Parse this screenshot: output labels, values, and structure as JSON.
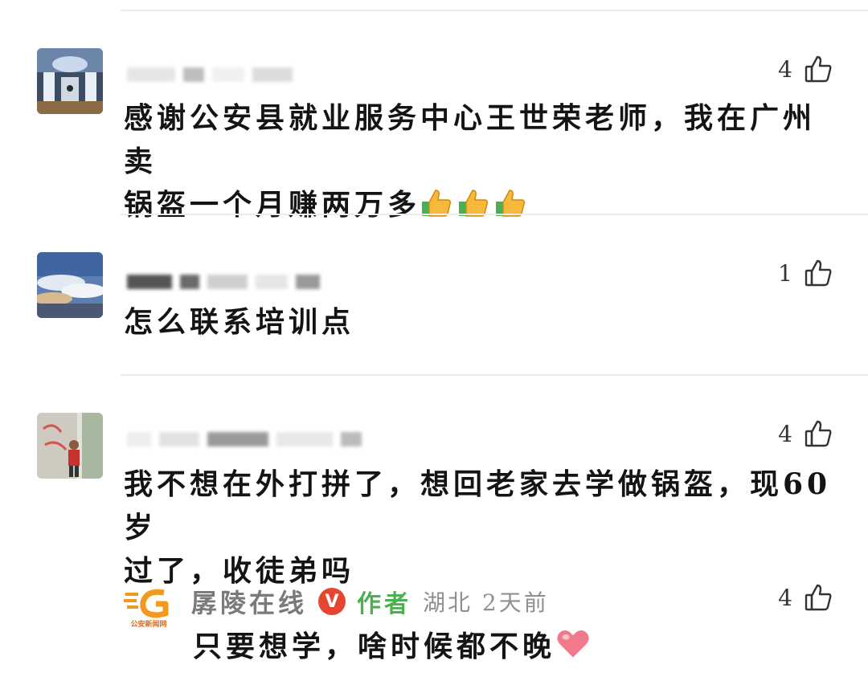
{
  "comments": [
    {
      "like_count": "4",
      "text_line1": "感谢公安县就业服务中心王世荣老师，我在广州卖",
      "text_line2": "锅盔一个月赚两万多"
    },
    {
      "like_count": "1",
      "text_line1": "怎么联系培训点"
    },
    {
      "like_count": "4",
      "text_line1": "我不想在外打拼了，想回老家去学做锅盔，现60岁",
      "text_line2": "过了，收徒弟吗",
      "reply": {
        "author": "孱陵在线",
        "verified": "V",
        "tag": "作者",
        "location_time": "湖北 2天前",
        "like_count": "4",
        "text": "只要想学，啥时候都不晚",
        "logo_caption": "公安新闻网"
      }
    }
  ],
  "icons": {
    "like": "thumbs-up-outline-icon",
    "emoji": "thumbs-up-emoji-icon",
    "heart": "heart-emoji-icon"
  },
  "colors": {
    "author_tag": "#4caf50",
    "verified_badge": "#e5462f",
    "logo_orange": "#f39a1e"
  }
}
